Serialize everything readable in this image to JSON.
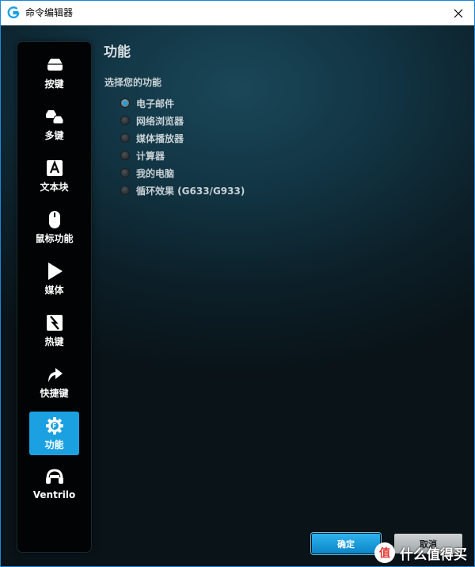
{
  "window": {
    "title": "命令编辑器"
  },
  "sidebar": {
    "items": [
      {
        "label": "按键",
        "icon": "key-icon"
      },
      {
        "label": "多键",
        "icon": "multikey-icon"
      },
      {
        "label": "文本块",
        "icon": "text-block-icon"
      },
      {
        "label": "鼠标功能",
        "icon": "mouse-icon"
      },
      {
        "label": "媒体",
        "icon": "play-icon"
      },
      {
        "label": "热键",
        "icon": "hotkey-icon"
      },
      {
        "label": "快捷键",
        "icon": "shortcut-arrow-icon"
      },
      {
        "label": "功能",
        "icon": "function-gear-icon",
        "active": true
      },
      {
        "label": "Ventrilo",
        "icon": "headset-icon"
      }
    ]
  },
  "main": {
    "title": "功能",
    "group_label": "选择您的功能",
    "options": [
      {
        "label": "电子邮件",
        "checked": true
      },
      {
        "label": "网络浏览器",
        "checked": false
      },
      {
        "label": "媒体播放器",
        "checked": false
      },
      {
        "label": "计算器",
        "checked": false
      },
      {
        "label": "我的电脑",
        "checked": false
      },
      {
        "label": "循环效果 (G633/G933)",
        "checked": false
      }
    ]
  },
  "buttons": {
    "ok": "确定",
    "cancel": "取消"
  },
  "watermark": {
    "badge": "值",
    "text": "什么值得买"
  },
  "colors": {
    "accent": "#1ba1e2",
    "window_border": "#1c87d8",
    "sidebar_bg": "#020304"
  }
}
